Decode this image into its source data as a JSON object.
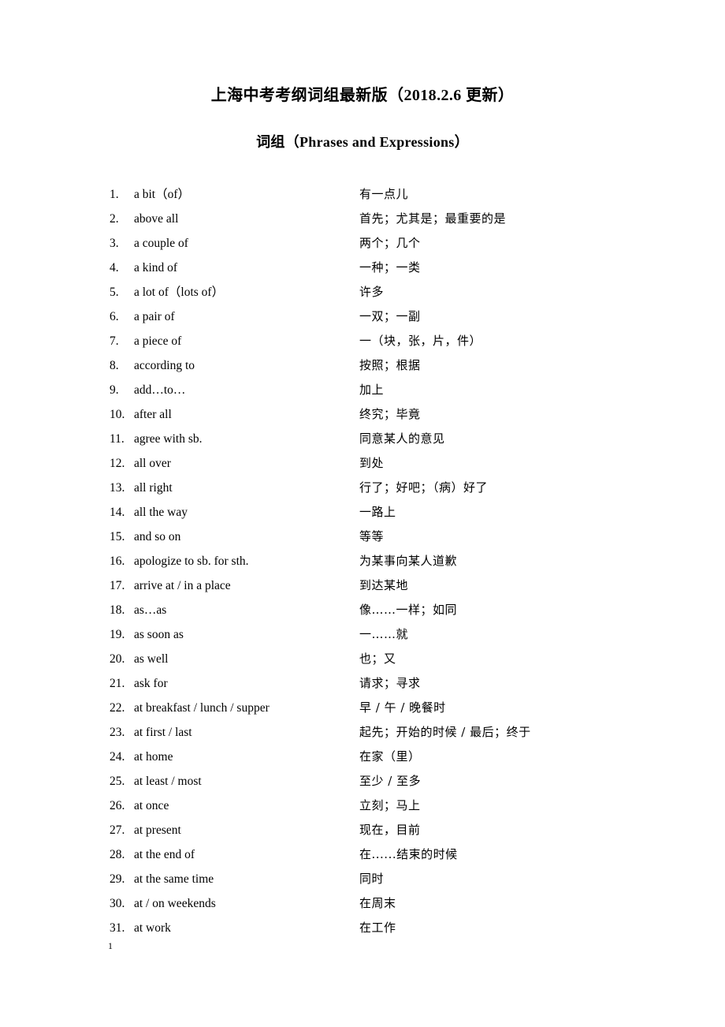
{
  "document": {
    "title": "上海中考考纲词组最新版（2018.2.6 更新）",
    "subtitle": "词组（Phrases and Expressions）",
    "page_number": "1"
  },
  "entries": [
    {
      "num": "1.",
      "english": "a bit（of）",
      "chinese": "有一点儿"
    },
    {
      "num": "2.",
      "english": "above all",
      "chinese": "首先；尤其是；最重要的是"
    },
    {
      "num": "3.",
      "english": "a couple of",
      "chinese": "两个；几个"
    },
    {
      "num": "4.",
      "english": "a kind of",
      "chinese": "一种；一类"
    },
    {
      "num": "5.",
      "english": "a lot of（lots of）",
      "chinese": "许多"
    },
    {
      "num": "6.",
      "english": "a pair of",
      "chinese": "一双；一副"
    },
    {
      "num": "7.",
      "english": "a piece of",
      "chinese": "一（块，张，片，件）"
    },
    {
      "num": "8.",
      "english": "according to",
      "chinese": "按照；根据"
    },
    {
      "num": "9.",
      "english": "add…to…",
      "chinese": "加上"
    },
    {
      "num": "10.",
      "english": "after all",
      "chinese": "终究；毕竟"
    },
    {
      "num": "11.",
      "english": "agree with sb.",
      "chinese": "同意某人的意见"
    },
    {
      "num": "12.",
      "english": "all over",
      "chinese": "到处"
    },
    {
      "num": "13.",
      "english": "all right",
      "chinese": "行了；好吧；（病）好了"
    },
    {
      "num": "14.",
      "english": "all the way",
      "chinese": "一路上"
    },
    {
      "num": "15.",
      "english": "and so on",
      "chinese": "等等"
    },
    {
      "num": "16.",
      "english": "apologize to sb. for sth.",
      "chinese": "为某事向某人道歉"
    },
    {
      "num": "17.",
      "english": "arrive at / in a place",
      "chinese": "到达某地"
    },
    {
      "num": "18.",
      "english": "as…as",
      "chinese": "像……一样；如同"
    },
    {
      "num": "19.",
      "english": "as soon as",
      "chinese": "一……就"
    },
    {
      "num": "20.",
      "english": "as well",
      "chinese": "也；又"
    },
    {
      "num": "21.",
      "english": "ask for",
      "chinese": "请求；寻求"
    },
    {
      "num": "22.",
      "english": "at breakfast / lunch / supper",
      "chinese": "早 / 午 / 晚餐时"
    },
    {
      "num": "23.",
      "english": "at first / last",
      "chinese": "起先；开始的时候 / 最后；终于"
    },
    {
      "num": "24.",
      "english": "at home",
      "chinese": "在家（里）"
    },
    {
      "num": "25.",
      "english": "at least / most",
      "chinese": "至少 / 至多"
    },
    {
      "num": "26.",
      "english": "at once",
      "chinese": "立刻；马上"
    },
    {
      "num": "27.",
      "english": "at present",
      "chinese": "现在，目前"
    },
    {
      "num": "28.",
      "english": "at the end of",
      "chinese": "在......结束的时候"
    },
    {
      "num": "29.",
      "english": "at the same time",
      "chinese": "同时"
    },
    {
      "num": "30.",
      "english": "at / on weekends",
      "chinese": "在周末"
    },
    {
      "num": "31.",
      "english": "at work",
      "chinese": "在工作"
    }
  ]
}
